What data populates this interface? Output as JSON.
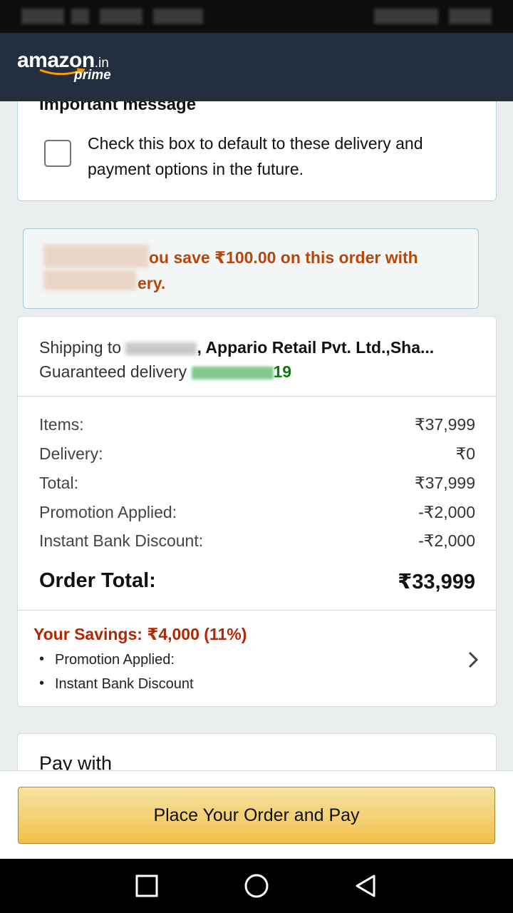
{
  "header": {
    "logo_main": "amazon",
    "logo_tld": ".in",
    "logo_sub": "prime"
  },
  "important": {
    "title": "Important message",
    "checkbox_text": "Check this box to default to these delivery and payment options in the future."
  },
  "savings_banner": {
    "text_line1": "ou save ₹100.00 on this order with",
    "text_line2": "ery."
  },
  "shipping": {
    "prefix": "Shipping to",
    "address": ", Appario Retail Pvt. Ltd.,Sha...",
    "delivery_prefix": "Guaranteed delivery",
    "delivery_date_suffix": "19"
  },
  "summary": {
    "rows": [
      {
        "label": "Items:",
        "value": "₹37,999"
      },
      {
        "label": "Delivery:",
        "value": "₹0"
      },
      {
        "label": "Total:",
        "value": "₹37,999"
      },
      {
        "label": "Promotion Applied:",
        "value": "-₹2,000"
      },
      {
        "label": "Instant Bank Discount:",
        "value": "-₹2,000"
      }
    ],
    "order_total_label": "Order Total:",
    "order_total_value": "₹33,999"
  },
  "your_savings": {
    "title": "Your Savings: ₹4,000 (11%)",
    "items": [
      "Promotion Applied:",
      "Instant Bank Discount"
    ]
  },
  "pay_with": "Pay with",
  "place_order": "Place Your Order and Pay",
  "colors": {
    "header_bg": "#232f3e",
    "savings_orange": "#b7460a",
    "savings_red": "#b12704",
    "delivery_green": "#067d06",
    "button_yellow": "#f0c14b"
  },
  "icons": [
    "checkbox-icon",
    "chevron-right-icon",
    "recent-apps-icon",
    "home-icon",
    "back-icon"
  ]
}
